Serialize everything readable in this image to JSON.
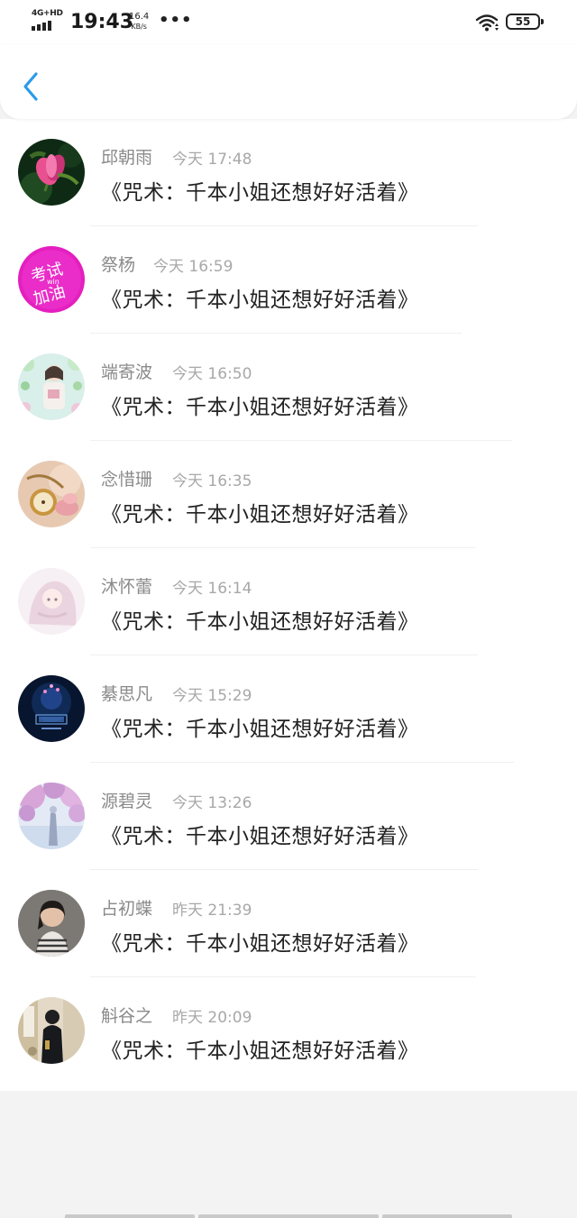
{
  "status_bar": {
    "network": "4G+HD",
    "time": "19:43",
    "speed_value": "16.4",
    "speed_unit": "KB/s",
    "dots": "•••",
    "battery": "55"
  },
  "header": {
    "back_icon": "chevron-left-icon",
    "accent_color": "#2b9bea"
  },
  "messages": [
    {
      "name": "邱朝雨",
      "time": "今天 17:48",
      "text": "《咒术：千本小姐还想好好活着》"
    },
    {
      "name": "祭杨",
      "time": "今天 16:59",
      "text": "《咒术：千本小姐还想好好活着》",
      "avatar_text_1": "考试",
      "avatar_text_2": "加油",
      "avatar_text_3": "win"
    },
    {
      "name": "端寄波",
      "time": "今天 16:50",
      "text": "《咒术：千本小姐还想好好活着》"
    },
    {
      "name": "念惜珊",
      "time": "今天 16:35",
      "text": "《咒术：千本小姐还想好好活着》"
    },
    {
      "name": "沐怀蕾",
      "time": "今天 16:14",
      "text": "《咒术：千本小姐还想好好活着》"
    },
    {
      "name": "綦思凡",
      "time": "今天 15:29",
      "text": "《咒术：千本小姐还想好好活着》"
    },
    {
      "name": "源碧灵",
      "time": "今天 13:26",
      "text": "《咒术：千本小姐还想好好活着》"
    },
    {
      "name": "占初蝶",
      "time": "昨天 21:39",
      "text": "《咒术：千本小姐还想好好活着》"
    },
    {
      "name": "斛谷之",
      "time": "昨天 20:09",
      "text": "《咒术：千本小姐还想好好活着》"
    }
  ]
}
